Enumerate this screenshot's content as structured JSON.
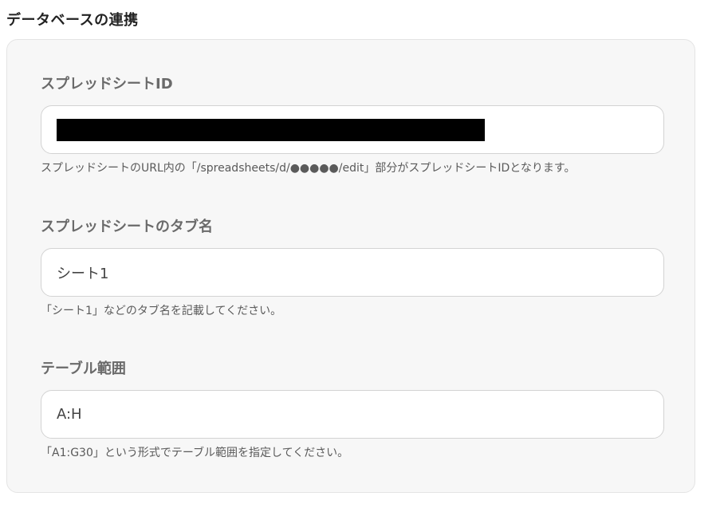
{
  "section": {
    "title": "データベースの連携"
  },
  "fields": [
    {
      "label": "スプレッドシートID",
      "value": "",
      "redacted": true,
      "help": "スプレッドシートのURL内の「/spreadsheets/d/●●●●●/edit」部分がスプレッドシートIDとなります。"
    },
    {
      "label": "スプレッドシートのタブ名",
      "value": "シート1",
      "help": "「シート1」などのタブ名を記載してください。"
    },
    {
      "label": "テーブル範囲",
      "value": "A:H",
      "help": "「A1:G30」という形式でテーブル範囲を指定してください。"
    }
  ],
  "colors": {
    "card_background": "#f7f7f7",
    "card_border": "#e4e4e4",
    "input_background": "#ffffff",
    "input_border": "#d3d3d3",
    "label_text": "#6a6a6a",
    "help_text": "#5a5a5a",
    "redaction": "#000000"
  }
}
